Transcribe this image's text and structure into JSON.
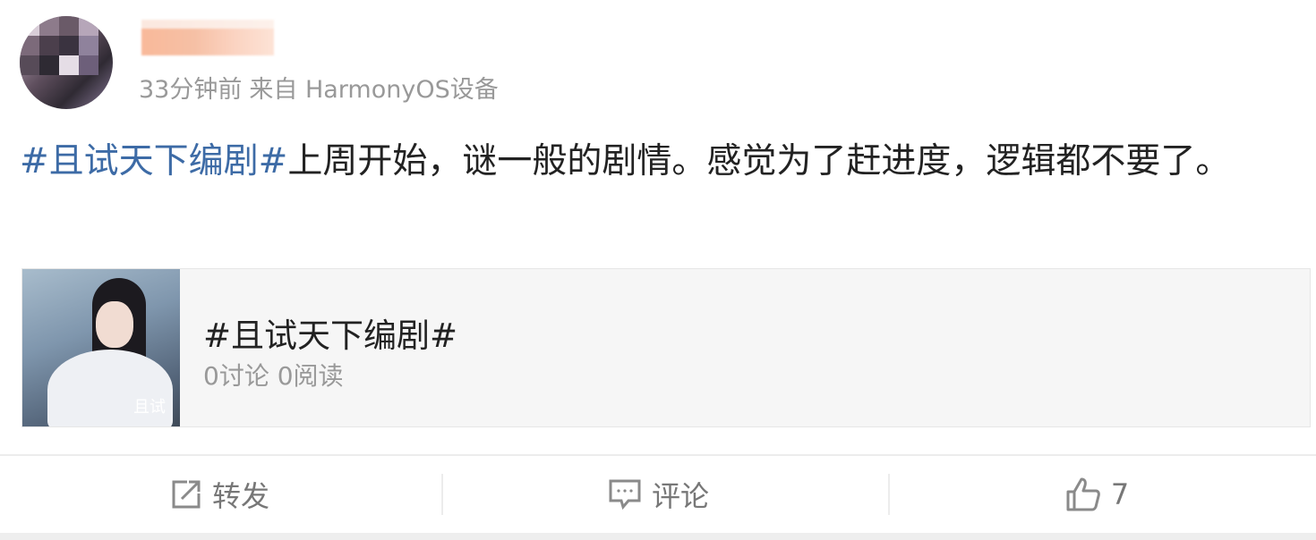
{
  "post": {
    "meta": {
      "time": "33分钟前",
      "source": "来自 HarmonyOS设备"
    },
    "content": {
      "hashtag": "#且试天下编剧#",
      "text": "上周开始，谜一般的剧情。感觉为了赶进度，逻辑都不要了。"
    },
    "card": {
      "title": "#且试天下编剧#",
      "stats": "0讨论 0阅读",
      "thumb_caption": "且试"
    },
    "actions": {
      "repost_label": "转发",
      "comment_label": "评论",
      "like_count": "7"
    },
    "icons": {
      "repost": "share-square-icon",
      "comment": "comment-bubble-icon",
      "like": "thumbs-up-icon"
    },
    "colors": {
      "hashtag": "#3d6ba6",
      "meta": "#999999",
      "text": "#222222",
      "action": "#777777"
    }
  }
}
